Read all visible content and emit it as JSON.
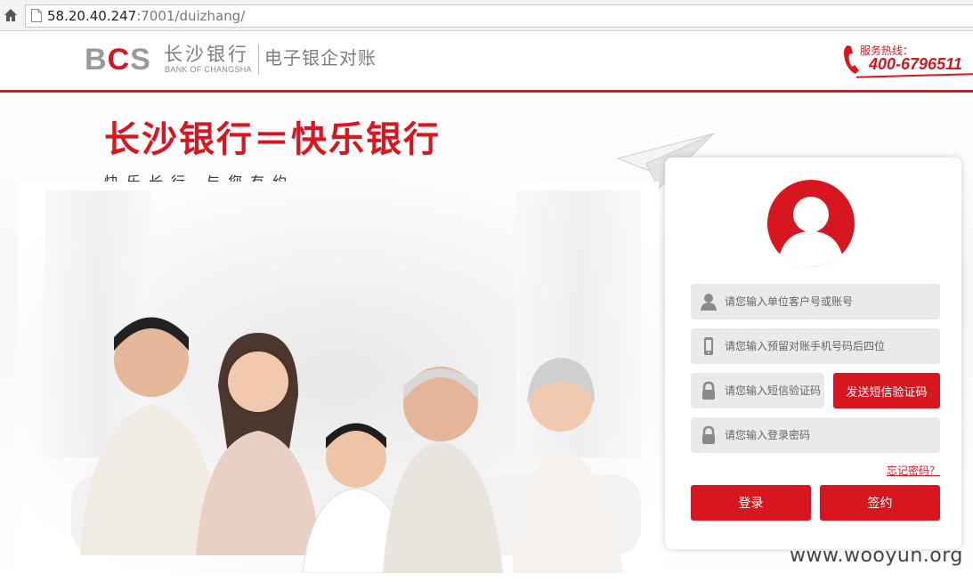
{
  "browser": {
    "url_host": "58.20.40.247",
    "url_rest": ":7001/duizhang/"
  },
  "header": {
    "logo_b": "B",
    "logo_c": "C",
    "logo_s": "S",
    "bank_name_cn": "长沙银行",
    "bank_name_en": "BANK OF CHANGSHA",
    "system_name": "电子银企对账",
    "hotline_label": "服务热线：",
    "hotline_number": "400-6796511"
  },
  "hero": {
    "slogan": "长沙银行＝快乐银行",
    "subslogan": "快乐长行 与您有约"
  },
  "login": {
    "account_placeholder": "请您输入单位客户号或账号",
    "phone_placeholder": "请您输入预留对账手机号码后四位",
    "sms_placeholder": "请您输入短信验证码",
    "send_sms_label": "发送短信验证码",
    "password_placeholder": "请您输入登录密码",
    "forgot_label": "忘记密码？",
    "login_label": "登录",
    "sign_label": "签约"
  },
  "watermark": "www.wooyun.org",
  "colors": {
    "brand_red": "#d7161f",
    "field_bg": "#eaeaea"
  },
  "icons": [
    "home-icon",
    "page-icon",
    "phone-hotline-icon",
    "user-avatar-icon",
    "person-icon",
    "mobile-icon",
    "lock-icon",
    "paper-plane-icon"
  ]
}
